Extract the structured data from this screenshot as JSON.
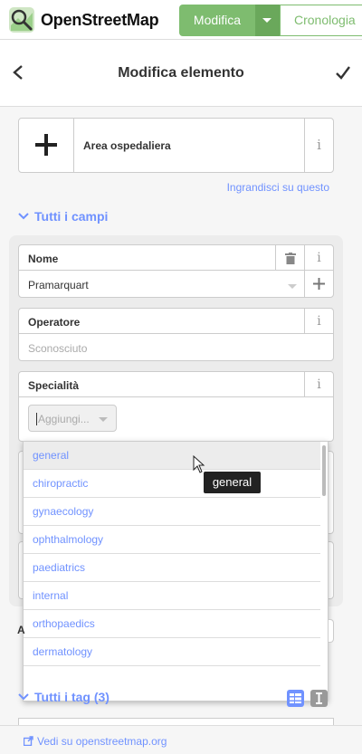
{
  "topbar": {
    "brand": "OpenStreetMap",
    "edit_label": "Modifica",
    "history_label": "Cronologia"
  },
  "sidebar": {
    "header_title": "Modifica elemento",
    "preset_name": "Area ospedaliera",
    "preset_info": "i",
    "zoom_link": "Ingrandisci su questo",
    "all_fields_label": "Tutti i campi",
    "fields": {
      "name": {
        "label": "Nome",
        "value": "Pramarquart",
        "info": "i"
      },
      "operator": {
        "label": "Operatore",
        "placeholder": "Sconosciuto",
        "info": "i"
      },
      "speciality": {
        "label": "Specialità",
        "placeholder": "Aggiungi...",
        "info": "i"
      }
    },
    "dropdown_options": [
      "general",
      "chiropractic",
      "gynaecology",
      "ophthalmology",
      "paediatrics",
      "internal",
      "orthopaedics",
      "dermatology"
    ],
    "tooltip": "general",
    "partial_label": "A",
    "all_tags_label": "Tutti i tag (3)",
    "footer_link": "Vedi su openstreetmap.org"
  },
  "colors": {
    "brand_green": "#7ebc6f",
    "link_blue": "#7092ff"
  }
}
